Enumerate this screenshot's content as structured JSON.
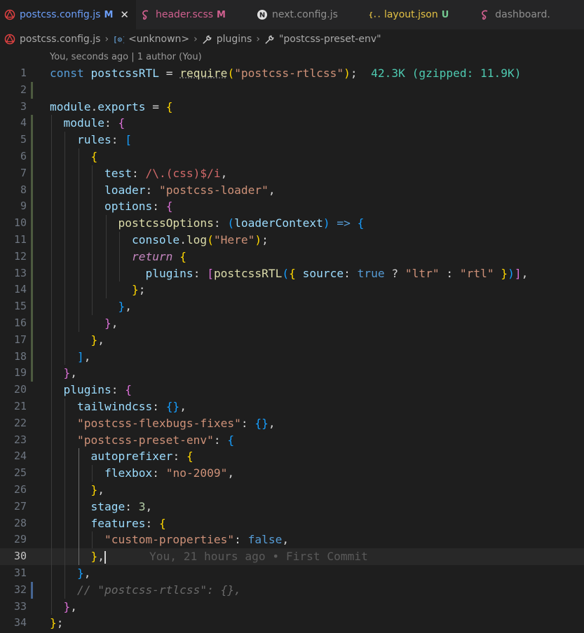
{
  "tabs": [
    {
      "label": "postcss.config.js",
      "badge": "M",
      "active": true,
      "icon": "postcss-icon",
      "color": "#e24242"
    },
    {
      "label": "header.scss",
      "badge": "M",
      "active": false,
      "icon": "sass-icon",
      "color": "#d0608f"
    },
    {
      "label": "next.config.js",
      "badge": "",
      "active": false,
      "icon": "nextjs-icon",
      "color": "#e0e0e0"
    },
    {
      "label": "layout.json",
      "badge": "U",
      "active": false,
      "icon": "json-icon",
      "color": "#e2c044"
    },
    {
      "label": "dashboard.",
      "badge": "",
      "active": false,
      "icon": "sass-icon",
      "color": "#d0608f"
    }
  ],
  "breadcrumb": {
    "file": "postcss.config.js",
    "obj": "<unknown>",
    "prop": "plugins",
    "item": "\"postcss-preset-env\""
  },
  "codelens": "You, seconds ago | 1 author (You)",
  "import_cost": "42.3K (gzipped: 11.9K)",
  "blame": "You, 21 hours ago • First Commit",
  "current_line": 30,
  "line_numbers": [
    "1",
    "2",
    "3",
    "4",
    "5",
    "6",
    "7",
    "8",
    "9",
    "10",
    "11",
    "12",
    "13",
    "14",
    "15",
    "16",
    "17",
    "18",
    "19",
    "20",
    "21",
    "22",
    "23",
    "24",
    "25",
    "26",
    "27",
    "28",
    "29",
    "30",
    "31",
    "32",
    "33",
    "34"
  ],
  "colors": {
    "keyword": "#569cd6",
    "string": "#ce9178",
    "variable": "#9cdcfe",
    "function": "#dcdcaa",
    "accent": "#6c9ef8"
  },
  "code": {
    "l1": [
      "const",
      "postcssRTL",
      "=",
      "require",
      "(",
      "\"postcss-rtlcss\"",
      ")",
      ";"
    ],
    "l3": [
      "module",
      ".",
      "exports",
      "=",
      "{"
    ],
    "l4": [
      "module",
      ":",
      "{"
    ],
    "l5": [
      "rules",
      ":",
      "["
    ],
    "l6": [
      "{"
    ],
    "l7": [
      "test",
      ":",
      "/\\.(css)$/i",
      ","
    ],
    "l8": [
      "loader",
      ":",
      "\"postcss-loader\"",
      ","
    ],
    "l9": [
      "options",
      ":",
      "{"
    ],
    "l10": [
      "postcssOptions",
      ":",
      "(",
      "loaderContext",
      ")",
      "=>",
      "{"
    ],
    "l11": [
      "console",
      ".",
      "log",
      "(",
      "\"Here\"",
      ")",
      ";"
    ],
    "l12": [
      "return",
      "{"
    ],
    "l13": [
      "plugins",
      ":",
      "[",
      "postcssRTL",
      "(",
      "{",
      "source",
      ":",
      "true",
      "?",
      "\"ltr\"",
      ":",
      "\"rtl\"",
      "}",
      ")",
      "]",
      ","
    ],
    "l14": [
      "}",
      ";"
    ],
    "l15": [
      "}",
      ","
    ],
    "l16": [
      "}",
      ","
    ],
    "l17": [
      "}",
      ","
    ],
    "l18": [
      "]",
      ","
    ],
    "l19": [
      "}",
      ","
    ],
    "l20": [
      "plugins",
      ":",
      "{"
    ],
    "l21": [
      "tailwindcss",
      ":",
      "{}",
      ","
    ],
    "l22": [
      "\"postcss-flexbugs-fixes\"",
      ":",
      "{}",
      ","
    ],
    "l23": [
      "\"postcss-preset-env\"",
      ":",
      "{"
    ],
    "l24": [
      "autoprefixer",
      ":",
      "{"
    ],
    "l25": [
      "flexbox",
      ":",
      "\"no-2009\"",
      ","
    ],
    "l26": [
      "}",
      ","
    ],
    "l27": [
      "stage",
      ":",
      "3",
      ","
    ],
    "l28": [
      "features",
      ":",
      "{"
    ],
    "l29": [
      "\"custom-properties\"",
      ":",
      "false",
      ","
    ],
    "l30": [
      "}",
      ","
    ],
    "l31": [
      "}",
      ","
    ],
    "l32": [
      "// \"postcss-rtlcss\": {},"
    ],
    "l33": [
      "}",
      ","
    ],
    "l34": [
      "}",
      ";"
    ]
  }
}
